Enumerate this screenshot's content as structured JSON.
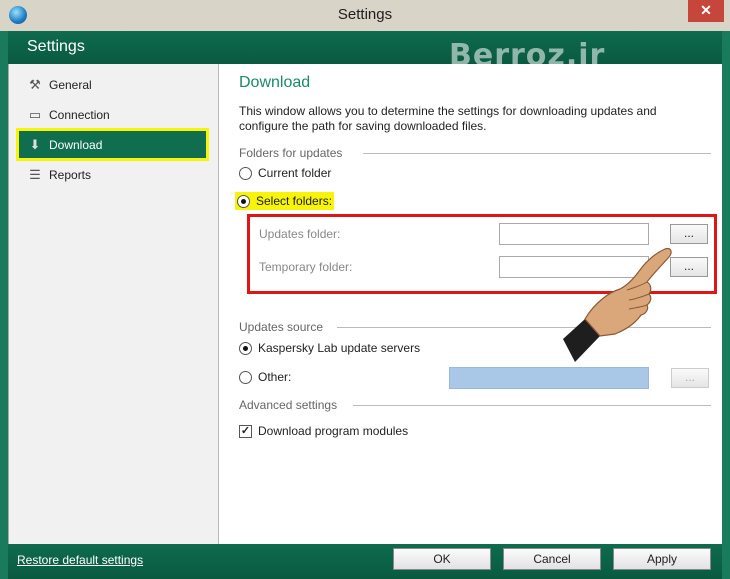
{
  "window": {
    "title": "Settings",
    "close_glyph": "✕"
  },
  "header": {
    "title": "Settings",
    "watermark": "Berroz.ir"
  },
  "sidebar": {
    "items": [
      {
        "label": "General",
        "icon": "tools-icon"
      },
      {
        "label": "Connection",
        "icon": "monitor-icon"
      },
      {
        "label": "Download",
        "icon": "download-icon",
        "active": true
      },
      {
        "label": "Reports",
        "icon": "report-icon"
      }
    ]
  },
  "content": {
    "title": "Download",
    "description": "This window allows you to determine the settings for downloading updates and configure the path for saving downloaded files.",
    "folders_section": "Folders for updates",
    "current_folder": "Current folder",
    "select_folders": "Select folders:",
    "updates_folder_label": "Updates folder:",
    "temporary_folder_label": "Temporary folder:",
    "browse": "...",
    "source_section": "Updates source",
    "kaspersky_servers": "Kaspersky Lab update servers",
    "other": "Other:",
    "advanced_section": "Advanced settings",
    "download_modules": "Download program modules"
  },
  "footer": {
    "restore": "Restore default settings",
    "ok": "OK",
    "cancel": "Cancel",
    "apply": "Apply"
  },
  "colors": {
    "accent": "#0f6e4e",
    "highlight": "#f7f40a",
    "red_box": "#e01515"
  }
}
